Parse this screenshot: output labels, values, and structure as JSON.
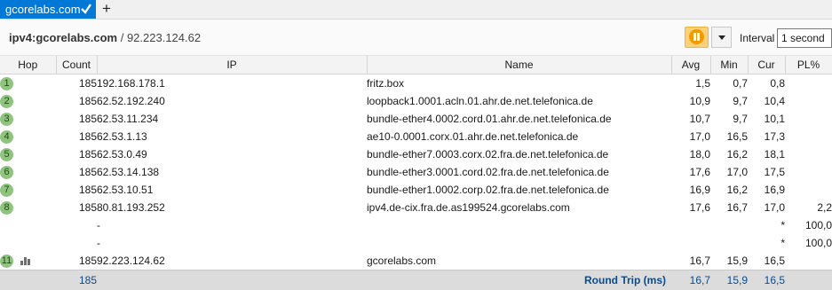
{
  "tab": {
    "label": "gcorelabs.com",
    "new_tab_symbol": "+"
  },
  "target": {
    "host": "ipv4:gcorelabs.com",
    "separator": " / ",
    "ip": "92.223.124.62"
  },
  "controls": {
    "interval_label": "Interval",
    "interval_value": "1 second"
  },
  "columns": {
    "hop": "Hop",
    "count": "Count",
    "ip": "IP",
    "name": "Name",
    "avg": "Avg",
    "min": "Min",
    "cur": "Cur",
    "pl": "PL%"
  },
  "hops": [
    {
      "hop": "1",
      "count": "185",
      "ip": "192.168.178.1",
      "name": "fritz.box",
      "avg": "1,5",
      "min": "0,7",
      "cur": "0,8",
      "pl": ""
    },
    {
      "hop": "2",
      "count": "185",
      "ip": "62.52.192.240",
      "name": "loopback1.0001.acln.01.ahr.de.net.telefonica.de",
      "avg": "10,9",
      "min": "9,7",
      "cur": "10,4",
      "pl": ""
    },
    {
      "hop": "3",
      "count": "185",
      "ip": "62.53.11.234",
      "name": "bundle-ether4.0002.cord.01.ahr.de.net.telefonica.de",
      "avg": "10,7",
      "min": "9,7",
      "cur": "10,1",
      "pl": ""
    },
    {
      "hop": "4",
      "count": "185",
      "ip": "62.53.1.13",
      "name": "ae10-0.0001.corx.01.ahr.de.net.telefonica.de",
      "avg": "17,0",
      "min": "16,5",
      "cur": "17,3",
      "pl": ""
    },
    {
      "hop": "5",
      "count": "185",
      "ip": "62.53.0.49",
      "name": "bundle-ether7.0003.corx.02.fra.de.net.telefonica.de",
      "avg": "18,0",
      "min": "16,2",
      "cur": "18,1",
      "pl": ""
    },
    {
      "hop": "6",
      "count": "185",
      "ip": "62.53.14.138",
      "name": "bundle-ether3.0001.cord.02.fra.de.net.telefonica.de",
      "avg": "17,6",
      "min": "17,0",
      "cur": "17,5",
      "pl": ""
    },
    {
      "hop": "7",
      "count": "185",
      "ip": "62.53.10.51",
      "name": "bundle-ether1.0002.corp.02.fra.de.net.telefonica.de",
      "avg": "16,9",
      "min": "16,2",
      "cur": "16,9",
      "pl": ""
    },
    {
      "hop": "8",
      "count": "185",
      "ip": "80.81.193.252",
      "name": "ipv4.de-cix.fra.de.as199524.gcorelabs.com",
      "avg": "17,6",
      "min": "16,7",
      "cur": "17,0",
      "pl": "2,2"
    },
    {
      "hop": "",
      "count": "",
      "ip": "-",
      "name": "",
      "avg": "",
      "min": "",
      "cur": "*",
      "pl": "100,0"
    },
    {
      "hop": "",
      "count": "",
      "ip": "-",
      "name": "",
      "avg": "",
      "min": "",
      "cur": "*",
      "pl": "100,0"
    },
    {
      "hop": "11",
      "count": "185",
      "ip": "92.223.124.62",
      "name": "gcorelabs.com",
      "avg": "16,7",
      "min": "15,9",
      "cur": "16,5",
      "pl": "",
      "graph_icon": "bar-chart-icon"
    }
  ],
  "footer": {
    "count": "185",
    "label": "Round Trip (ms)",
    "avg": "16,7",
    "min": "15,9",
    "cur": "16,5"
  },
  "colors": {
    "tab_active": "#0078d7",
    "hop_badge": "#8fc47f",
    "pause_button": "#fbd27a",
    "footer_text": "#0b4a8b"
  }
}
